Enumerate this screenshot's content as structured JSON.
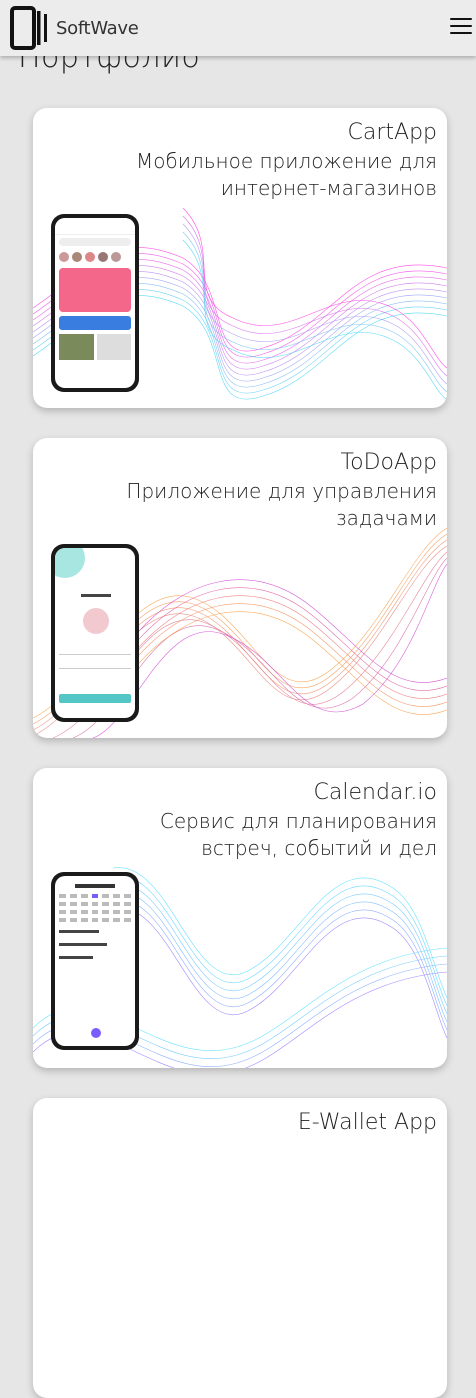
{
  "header": {
    "brand": "SoftWave",
    "menu_icon": "hamburger-menu-icon"
  },
  "page_title": "Портфолио",
  "projects": [
    {
      "title": "CartApp",
      "description": "Мобильное приложение для интернет-магазинов",
      "colors": [
        "#ff3ee3",
        "#49d6f5"
      ]
    },
    {
      "title": "ToDoApp",
      "description": "Приложение для управления задачами",
      "colors": [
        "#f9a24b",
        "#d14bd0"
      ]
    },
    {
      "title": "Calendar.io",
      "description": "Сервис для планирования встреч, событий и дел",
      "colors": [
        "#58e0ff",
        "#9a7bff"
      ]
    },
    {
      "title": "E-Wallet App",
      "description": ""
    }
  ]
}
